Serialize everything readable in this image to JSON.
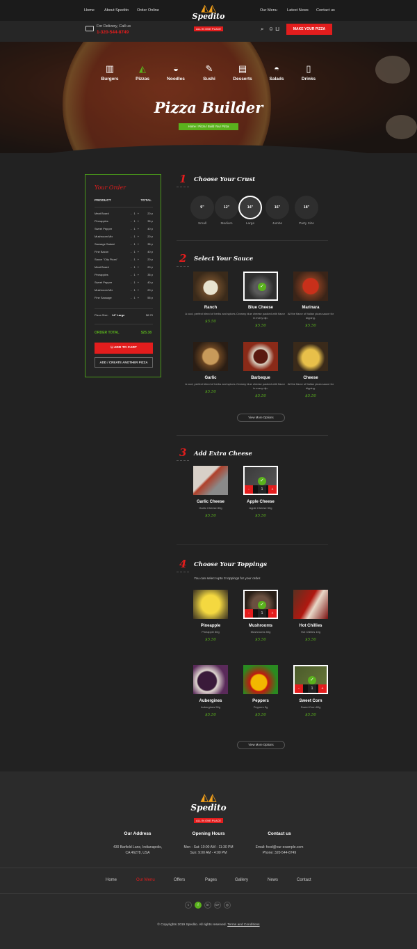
{
  "nav": {
    "left": [
      "Home",
      "About Spedito",
      "Order Online"
    ],
    "right": [
      "Our Menu",
      "Latest News",
      "Contact us"
    ]
  },
  "brand": {
    "name": "Spedito",
    "tagline": "ALL IN ONE PLACE"
  },
  "delivery": {
    "label": "For Delivery, Call us",
    "phone": "1-320-544-8749"
  },
  "header_cta": "MAKE YOUR PIZZA",
  "header_icons": [
    "search-icon",
    "user-icon",
    "cart-icon"
  ],
  "categories": [
    "Burgers",
    "Pizzas",
    "Noodles",
    "Sushi",
    "Desserts",
    "Salads",
    "Drinks"
  ],
  "hero": {
    "title": "Pizza Builder",
    "breadcrumb": "Home / Pizza / Build Your Pizza"
  },
  "order": {
    "title": "Your Order",
    "col_product": "PRODUCT",
    "col_total": "TOTAL",
    "items": [
      {
        "name": "Meat Board",
        "qty": "- 1 +",
        "price": "20 p"
      },
      {
        "name": "Pineapples",
        "qty": "- 1 +",
        "price": "35 p"
      },
      {
        "name": "Sweet Pepper",
        "qty": "- 1 +",
        "price": "40 p"
      },
      {
        "name": "Mushroom Mix",
        "qty": "- 1 +",
        "price": "20 p"
      },
      {
        "name": "Sausage Salami",
        "qty": "- 1 +",
        "price": "35 p"
      },
      {
        "name": "Fine Bacon",
        "qty": "- 1 +",
        "price": "40 p"
      },
      {
        "name": "Sauce \"City Pizza\"",
        "qty": "- 1 +",
        "price": "20 p"
      },
      {
        "name": "Meat Board",
        "qty": "- 1 +",
        "price": "20 p"
      },
      {
        "name": "Pineapples",
        "qty": "- 1 +",
        "price": "35 p"
      },
      {
        "name": "Sweet Pepper",
        "qty": "- 1 +",
        "price": "40 p"
      },
      {
        "name": "Mushroom Mix",
        "qty": "- 1 +",
        "price": "20 p"
      },
      {
        "name": "Fine Sausage",
        "qty": "- 1 +",
        "price": "55 p"
      }
    ],
    "size_label": "Pizza Size:",
    "size_value": "14\" Large",
    "size_price": "$6.70",
    "total_label": "ORDER TOTAL",
    "total_value": "$25.38",
    "add_to_cart": "ADD TO CART",
    "add_another": "ADD / CREATE ANOTHER PIZZA"
  },
  "steps": {
    "crust": {
      "num": "1",
      "title": "Choose Your Crust",
      "sizes": [
        {
          "size": "9\"",
          "label": "Small"
        },
        {
          "size": "12\"",
          "label": "Medium"
        },
        {
          "size": "14\"",
          "label": "Large"
        },
        {
          "size": "16\"",
          "label": "Jumbo"
        },
        {
          "size": "18\"",
          "label": "Party Size"
        }
      ],
      "selected": "14\""
    },
    "sauce": {
      "num": "2",
      "title": "Select Your Sauce",
      "items": [
        {
          "name": "Ranch",
          "desc": "A cool, perfect blend of herbs and spices.",
          "price": "$5.50",
          "selected": false
        },
        {
          "name": "Blue Cheese",
          "desc": "Creamy blue cheese packed with flavor in every dip.",
          "price": "$5.50",
          "selected": true
        },
        {
          "name": "Marinara",
          "desc": "All the flavor of Italian pizza sauce for dipping.",
          "price": "$5.50",
          "selected": false
        },
        {
          "name": "Garlic",
          "desc": "A cool, perfect blend of herbs and spices.",
          "price": "$5.50",
          "selected": false
        },
        {
          "name": "Barbeque",
          "desc": "Creamy blue cheese packed with flavor in every dip.",
          "price": "$5.50",
          "selected": false
        },
        {
          "name": "Cheese",
          "desc": "All the flavor of Italian pizza sauce for dipping.",
          "price": "$5.50",
          "selected": false
        }
      ],
      "view_more": "View More Options"
    },
    "cheese": {
      "num": "3",
      "title": "Add Extra Cheese",
      "items": [
        {
          "name": "Garlic Cheese",
          "desc": "Garlic Cheese 80g",
          "price": "$5.50",
          "selected": false
        },
        {
          "name": "Apple Cheese",
          "desc": "Apple Cheese 50g",
          "price": "$5.50",
          "selected": true,
          "qty": "1"
        }
      ]
    },
    "toppings": {
      "num": "4",
      "title": "Choose Your Toppings",
      "note": "You can select upto 3 toppings for your order.",
      "items": [
        {
          "name": "Pineapple",
          "desc": "Pineapple 80g",
          "price": "$5.50",
          "selected": false
        },
        {
          "name": "Mushrooms",
          "desc": "Mushrooms 50g",
          "price": "$5.50",
          "selected": true,
          "qty": "1"
        },
        {
          "name": "Hot Chillies",
          "desc": "Hot Chillies 10g",
          "price": "$5.50",
          "selected": false
        },
        {
          "name": "Aubergines",
          "desc": "Aubergines 50g",
          "price": "$5.50",
          "selected": false
        },
        {
          "name": "Peppers",
          "desc": "Peppers 5g",
          "price": "$5.50",
          "selected": false
        },
        {
          "name": "Sweet Corn",
          "desc": "Sweet Corn 80g",
          "price": "$5.50",
          "selected": true,
          "qty": "1"
        }
      ],
      "view_more": "View More Options"
    }
  },
  "footer": {
    "address": {
      "title": "Our Address",
      "lines": [
        "430 Barfield Lane, Indianapolis,",
        "CA 46278, USA"
      ]
    },
    "hours": {
      "title": "Opening Hours",
      "lines": [
        "Mon - Sat: 10:00 AM - 11:30 PM",
        "Sun: 9:00 AM - 4:00 PM"
      ]
    },
    "contact": {
      "title": "Contact us",
      "lines": [
        "Email: food@our-example.com",
        "Phone: 320-544-8749"
      ]
    },
    "nav": [
      "Home",
      "Our Menu",
      "Offers",
      "Pages",
      "Gallery",
      "News",
      "Contact"
    ],
    "active_nav": "Our Menu",
    "social": [
      "twitter-icon",
      "facebook-icon",
      "linkedin-icon",
      "google-plus-icon",
      "instagram-icon"
    ],
    "copyright": "© Copyrights 2019 Spedito. All rights reserved.",
    "terms": "Terms and Conditions"
  },
  "colors": {
    "accent": "#e31d1d",
    "green": "#5ab21d",
    "bg": "#222222",
    "panel": "#2b2b2b"
  }
}
